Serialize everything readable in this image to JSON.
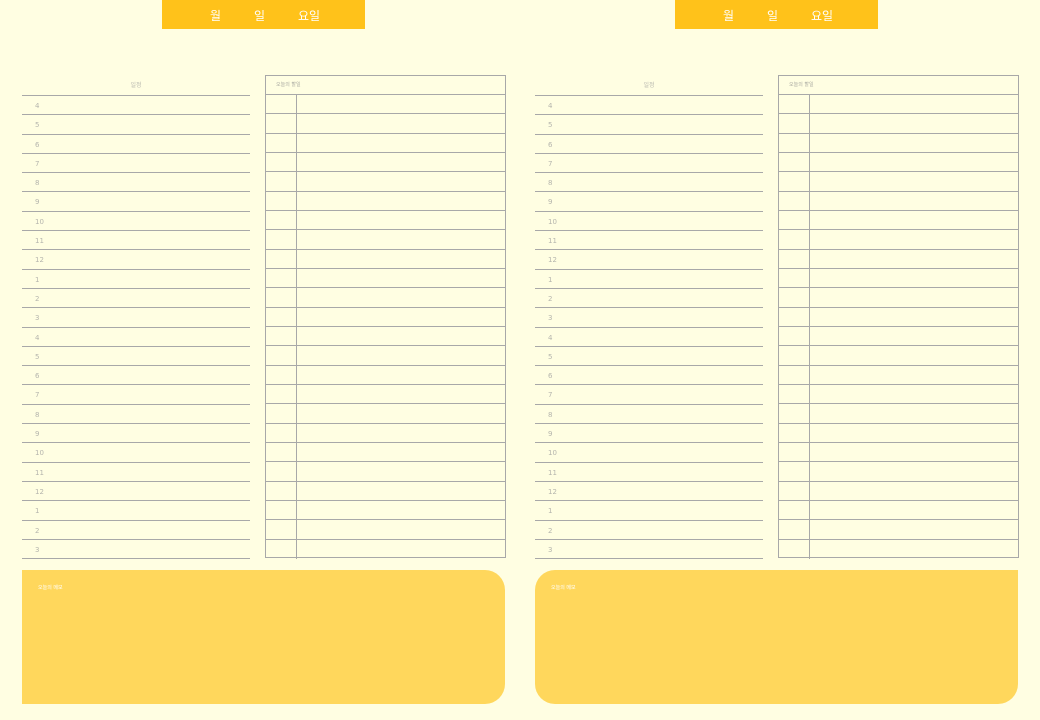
{
  "header": {
    "month": "월",
    "day": "일",
    "weekday": "요일"
  },
  "schedule": {
    "title": "일정",
    "hours": [
      "4",
      "5",
      "6",
      "7",
      "8",
      "9",
      "10",
      "11",
      "12",
      "1",
      "2",
      "3",
      "4",
      "5",
      "6",
      "7",
      "8",
      "9",
      "10",
      "11",
      "12",
      "1",
      "2",
      "3"
    ]
  },
  "todo": {
    "title": "오늘의 할일",
    "row_count": 24
  },
  "memo": {
    "label": "오늘의 메모"
  },
  "colors": {
    "background": "#fffee2",
    "header": "#ffc21a",
    "memo": "#ffd75c",
    "lines": "#a8a8a8"
  }
}
